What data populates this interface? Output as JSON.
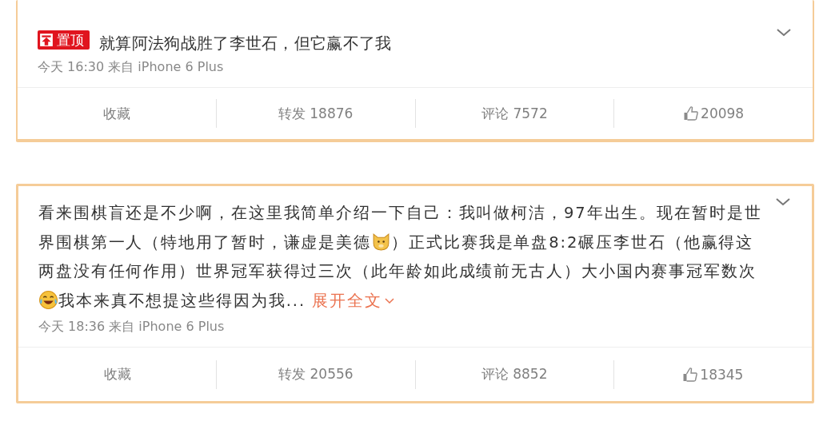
{
  "posts": [
    {
      "pinned_badge": "置顶",
      "body": [
        {
          "kind": "text",
          "text": "就算阿法狗战胜了李世石，但它赢不了我"
        }
      ],
      "meta": "今天 16:30 来自 iPhone 6 Plus",
      "actions": {
        "favorite": "收藏",
        "repost": "转发 18876",
        "comment": "评论 7572",
        "like": "20098"
      }
    },
    {
      "body": [
        {
          "kind": "text",
          "text": "看来围棋盲还是不少啊，在这里我简单介绍一下自己：我叫做柯洁，97年出生。现在暂时是世界围棋第一人（特地用了暂时，谦虚是美德"
        },
        {
          "kind": "dog_emoji"
        },
        {
          "kind": "text",
          "text": "）正式比赛我是单盘8:2碾压李世石（他赢得这两盘没有任何作用）世界冠军获得过三次（此年龄如此成绩前无古人）大小国内赛事冠军数次"
        },
        {
          "kind": "laugh_emoji"
        },
        {
          "kind": "text",
          "text": "我本来真不想提这些得因为我..."
        }
      ],
      "expand_link": "展开全文",
      "meta": "今天 18:36 来自 iPhone 6 Plus",
      "actions": {
        "favorite": "收藏",
        "repost": "转发 20556",
        "comment": "评论 8852",
        "like": "18345"
      }
    }
  ]
}
